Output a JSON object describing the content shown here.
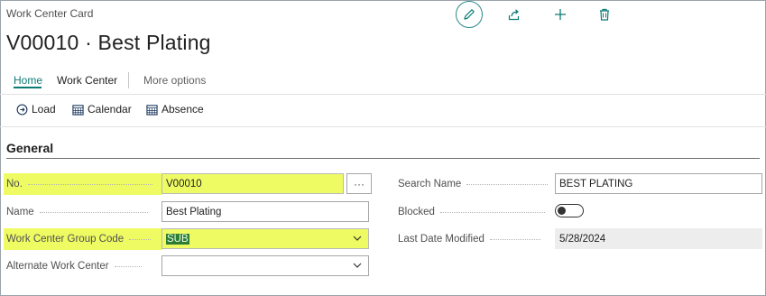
{
  "page": {
    "caption": "Work Center Card",
    "title": "V00010 · Best Plating"
  },
  "actions": [
    {
      "name": "edit",
      "icon": "pencil-icon"
    },
    {
      "name": "share",
      "icon": "share-icon"
    },
    {
      "name": "new",
      "icon": "plus-icon"
    },
    {
      "name": "delete",
      "icon": "trash-icon"
    }
  ],
  "nav": {
    "tabs": [
      "Home",
      "Work Center",
      "More options"
    ],
    "active": "Home"
  },
  "toolbar": {
    "load": "Load",
    "calendar": "Calendar",
    "absence": "Absence"
  },
  "general": {
    "title": "General",
    "no": {
      "label": "No.",
      "value": "V00010"
    },
    "name": {
      "label": "Name",
      "value": "Best Plating"
    },
    "group_code": {
      "label": "Work Center Group Code",
      "value": "SUB"
    },
    "alternate": {
      "label": "Alternate Work Center",
      "value": ""
    },
    "search_name": {
      "label": "Search Name",
      "value": "BEST PLATING"
    },
    "blocked": {
      "label": "Blocked",
      "value": false
    },
    "last_modified": {
      "label": "Last Date Modified",
      "value": "5/28/2024"
    }
  },
  "colors": {
    "accent": "#0b7a75",
    "highlight": "#eefb62"
  }
}
